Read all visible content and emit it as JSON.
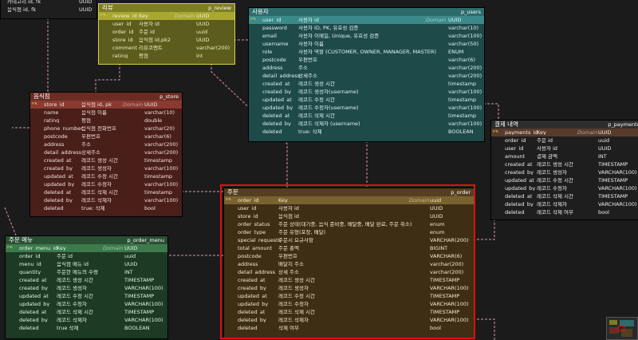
{
  "colors": {
    "review": "#7d7d24",
    "users": "#2d6b6b",
    "store": "#6b2c24",
    "payments": "#2d2d2d",
    "order": "#544020",
    "order_menu": "#2a5034",
    "highlight": "#e01010",
    "connector": "#d896b8"
  },
  "tables": {
    "partial": {
      "rows": [
        {
          "name": "카테고리 id, fk",
          "domain": "",
          "type": "UUID"
        },
        {
          "name": "음식점 id, fk",
          "domain": "",
          "type": "UUID"
        }
      ]
    },
    "review": {
      "label": "리뷰",
      "physical": "p_review",
      "header": {
        "key": "",
        "name": "review_id",
        "logical": "Key",
        "domain": "Domain",
        "type": "UUID"
      },
      "rows": [
        {
          "key": "",
          "name": "user_id",
          "logical": "사용자 id",
          "domain": "",
          "type": "UUID"
        },
        {
          "key": "",
          "name": "order_id",
          "logical": "주문 id",
          "domain": "",
          "type": "uuid"
        },
        {
          "key": "",
          "name": "store_id",
          "logical": "음식점 id,pk2",
          "domain": "",
          "type": "UUID"
        },
        {
          "key": "",
          "name": "comment",
          "logical": "리뷰코멘트",
          "domain": "",
          "type": "varchar(200)"
        },
        {
          "key": "",
          "name": "rating",
          "logical": "평점",
          "domain": "",
          "type": "int"
        }
      ]
    },
    "users": {
      "label": "사용자",
      "physical": "p_users",
      "header": {
        "name": "user_id",
        "logical": "사용자 id",
        "domain": "Domain",
        "type": "UUID"
      },
      "rows": [
        {
          "name": "password",
          "logical": "사용자 ID, PK, 유효성 검증",
          "domain": "",
          "type": "varchar(10)"
        },
        {
          "name": "email",
          "logical": "사용자 이메일, Unique, 유효성 검증",
          "domain": "",
          "type": "varchar(100)"
        },
        {
          "name": "username",
          "logical": "사용자 이름",
          "domain": "",
          "type": "varchar(50)"
        },
        {
          "name": "role",
          "logical": "사용자 역할 (CUSTOMER, OWNER, MANAGER, MASTER)",
          "domain": "",
          "type": "ENUM"
        },
        {
          "name": "postcode",
          "logical": "우편번호",
          "domain": "",
          "type": "varchar(6)"
        },
        {
          "name": "address",
          "logical": "주소",
          "domain": "",
          "type": "varchar(200)"
        },
        {
          "name": "detail_address",
          "logical": "상세주소",
          "domain": "",
          "type": "varchar(200)"
        },
        {
          "name": "created_at",
          "logical": "레코드 생성 시간",
          "domain": "",
          "type": "timestamp"
        },
        {
          "name": "created_by",
          "logical": "레코드 생성자(username)",
          "domain": "",
          "type": "varchar(100)"
        },
        {
          "name": "updated_at",
          "logical": "레코드 수정 시간",
          "domain": "",
          "type": "timestamp"
        },
        {
          "name": "updated_by",
          "logical": "레코드 수정자(username)",
          "domain": "",
          "type": "varchar(100)"
        },
        {
          "name": "deleted_at",
          "logical": "레코드 삭제 시간",
          "domain": "",
          "type": "timestamp"
        },
        {
          "name": "deleted_by",
          "logical": "레코드 삭제자 (username)",
          "domain": "",
          "type": "varchar(100)"
        },
        {
          "name": "deleted",
          "logical": "true: 삭제",
          "domain": "",
          "type": "BOOLEAN"
        }
      ]
    },
    "store": {
      "label": "음식점",
      "physical": "p_store",
      "header": {
        "name": "store_id",
        "logical": "음식점 id, pk",
        "domain": "Domain",
        "type": "UUID"
      },
      "rows": [
        {
          "name": "name",
          "logical": "음식점 이름",
          "domain": "",
          "type": "varchar(10)"
        },
        {
          "name": "rating",
          "logical": "평점",
          "domain": "",
          "type": "double"
        },
        {
          "name": "phone_number",
          "logical": "음식점 전화번호",
          "domain": "",
          "type": "varchar(20)"
        },
        {
          "name": "postcode",
          "logical": "우편번호",
          "domain": "",
          "type": "varchar(6)"
        },
        {
          "name": "address",
          "logical": "주소",
          "domain": "",
          "type": "varchar(200)"
        },
        {
          "name": "detail_address",
          "logical": "상세주소",
          "domain": "",
          "type": "varchar(200)"
        },
        {
          "name": "created_at",
          "logical": "레코드 생성 시간",
          "domain": "",
          "type": "timestamp"
        },
        {
          "name": "created_by",
          "logical": "레코드 생성자",
          "domain": "",
          "type": "varchar(100)"
        },
        {
          "name": "updated_at",
          "logical": "레코드 수정 시간",
          "domain": "",
          "type": "timestamp"
        },
        {
          "name": "updated_by",
          "logical": "레코드 수정자",
          "domain": "",
          "type": "varchar(100)"
        },
        {
          "name": "deleted_at",
          "logical": "레코드 삭제 시간",
          "domain": "",
          "type": "timestamp"
        },
        {
          "name": "deleted_by",
          "logical": "레코드 삭제자",
          "domain": "",
          "type": "varchar(100)"
        },
        {
          "name": "deleted",
          "logical": "true: 삭제",
          "domain": "",
          "type": "bool"
        }
      ]
    },
    "payments": {
      "label": "결제 내역",
      "physical": "p_payments",
      "header": {
        "name": "payments_id",
        "logical": "Key",
        "domain": "Domain",
        "type": "UUID"
      },
      "rows": [
        {
          "name": "order_id",
          "logical": "주문 id",
          "domain": "",
          "type": "uuid"
        },
        {
          "name": "user_id",
          "logical": "사용자 id",
          "domain": "",
          "type": "UUID"
        },
        {
          "name": "amount",
          "logical": "결제 금액",
          "domain": "",
          "type": "INT"
        },
        {
          "name": "created_at",
          "logical": "레코드 생성 시간",
          "domain": "",
          "type": "TIMESTAMP"
        },
        {
          "name": "created_by",
          "logical": "레코드 생성자",
          "domain": "",
          "type": "VARCHAR(100)"
        },
        {
          "name": "updated_at",
          "logical": "레코드 수정 시간",
          "domain": "",
          "type": "TIMESTAMP"
        },
        {
          "name": "updated_by",
          "logical": "레코드 수정자",
          "domain": "",
          "type": "VARCHAR(100)"
        },
        {
          "name": "deleted_at",
          "logical": "레코드 삭제 시간",
          "domain": "",
          "type": "TIMESTAMP"
        },
        {
          "name": "deleted_by",
          "logical": "레코드 삭제자",
          "domain": "",
          "type": "VARCHAR(100)"
        },
        {
          "name": "deleted",
          "logical": "레코드 삭제 여부",
          "domain": "",
          "type": "bool"
        }
      ]
    },
    "order": {
      "label": "주문",
      "physical": "p_order",
      "header": {
        "name": "order_id",
        "logical": "Key",
        "domain": "Domain",
        "type": "uuid"
      },
      "rows": [
        {
          "name": "user_id",
          "logical": "사용자 id",
          "domain": "",
          "type": "UUID"
        },
        {
          "name": "store_id",
          "logical": "음식점 id",
          "domain": "",
          "type": "UUID"
        },
        {
          "name": "order_status",
          "logical": "주문 상태(대기중, 음식 준비중, 배달중, 배달 완료, 주문 취소)",
          "domain": "",
          "type": "enum"
        },
        {
          "name": "order_type",
          "logical": "주문 유형(포장, 배달)",
          "domain": "",
          "type": "enum"
        },
        {
          "name": "special_requests",
          "logical": "주문시 요규사항",
          "domain": "",
          "type": "VARCHAR(200)"
        },
        {
          "name": "total_amount",
          "logical": "주문 총액",
          "domain": "",
          "type": "BIGINT"
        },
        {
          "name": "postcode",
          "logical": "우편번호",
          "domain": "",
          "type": "VARCHAR(6)"
        },
        {
          "name": "address",
          "logical": "배달지 주소",
          "domain": "",
          "type": "varchar(200)"
        },
        {
          "name": "detail_address",
          "logical": "상세 주소",
          "domain": "",
          "type": "varchar(200)"
        },
        {
          "name": "created_at",
          "logical": "레코드 생성 시간",
          "domain": "",
          "type": "TIMESTAMP"
        },
        {
          "name": "created_by",
          "logical": "레코드 생성자",
          "domain": "",
          "type": "VARCHAR(100)"
        },
        {
          "name": "updated_at",
          "logical": "레코드 수정 시간",
          "domain": "",
          "type": "TIMESTAMP"
        },
        {
          "name": "updated_by",
          "logical": "레코드 수정자",
          "domain": "",
          "type": "VARCHAR(100)"
        },
        {
          "name": "deleted_at",
          "logical": "레코드 삭제 시간",
          "domain": "",
          "type": "TIMESTAMP"
        },
        {
          "name": "deleted_by",
          "logical": "레코드 삭제자",
          "domain": "",
          "type": "VARCHAR(100)"
        },
        {
          "name": "deleted",
          "logical": "삭제 여부",
          "domain": "",
          "type": "bool"
        }
      ]
    },
    "order_menu": {
      "label": "주문 메뉴",
      "physical": "p_order_menu",
      "header": {
        "name": "order_menu_id",
        "logical": "Key",
        "domain": "Domain",
        "type": "UUID"
      },
      "rows": [
        {
          "name": "order_id",
          "logical": "주문 id",
          "domain": "",
          "type": "uuid"
        },
        {
          "name": "menu_id",
          "logical": "음식점 메뉴 id",
          "domain": "",
          "type": "UUID"
        },
        {
          "name": "quantity",
          "logical": "주문한 메뉴의 수량",
          "domain": "",
          "type": "INT"
        },
        {
          "name": "created_at",
          "logical": "레코드 생성 시간",
          "domain": "",
          "type": "TIMESTAMP"
        },
        {
          "name": "created_by",
          "logical": "레코드 생성자",
          "domain": "",
          "type": "VARCHAR(100)"
        },
        {
          "name": "updated_at",
          "logical": "레코드 수정 시간",
          "domain": "",
          "type": "TIMESTAMP"
        },
        {
          "name": "updated_by",
          "logical": "레코드 수정자",
          "domain": "",
          "type": "VARCHAR(100)"
        },
        {
          "name": "deleted_at",
          "logical": "레코드 삭제 시간",
          "domain": "",
          "type": "TIMESTAMP"
        },
        {
          "name": "deleted_by",
          "logical": "레코드 삭제자",
          "domain": "",
          "type": "VARCHAR(100)"
        },
        {
          "name": "deleted",
          "logical": "true 삭제",
          "domain": "",
          "type": "BOOLEAN"
        }
      ]
    }
  },
  "key_icon_label": "PK"
}
